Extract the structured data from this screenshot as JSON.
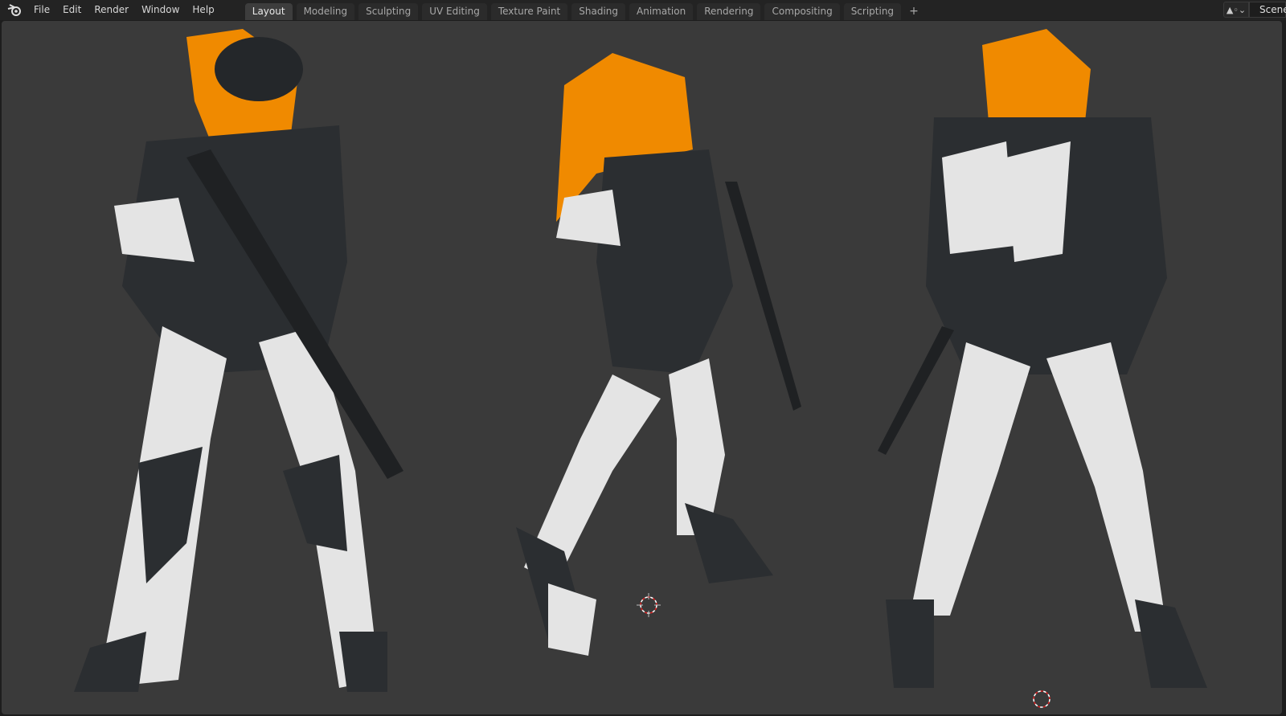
{
  "menu": {
    "items": [
      "File",
      "Edit",
      "Render",
      "Window",
      "Help"
    ]
  },
  "workspaces": {
    "tabs": [
      "Layout",
      "Modeling",
      "Sculpting",
      "UV Editing",
      "Texture Paint",
      "Shading",
      "Animation",
      "Rendering",
      "Compositing",
      "Scripting"
    ],
    "active": "Layout",
    "add_label": "+"
  },
  "scene": {
    "name": "Scene",
    "icon": "scene-icon"
  },
  "colors": {
    "viewport": "#3a3a3a",
    "hair": "#f08a00",
    "armor_dark": "#2b2e31",
    "armor_white": "#e4e4e4",
    "accent": "#f0a800",
    "teal": "#1f4a55"
  }
}
